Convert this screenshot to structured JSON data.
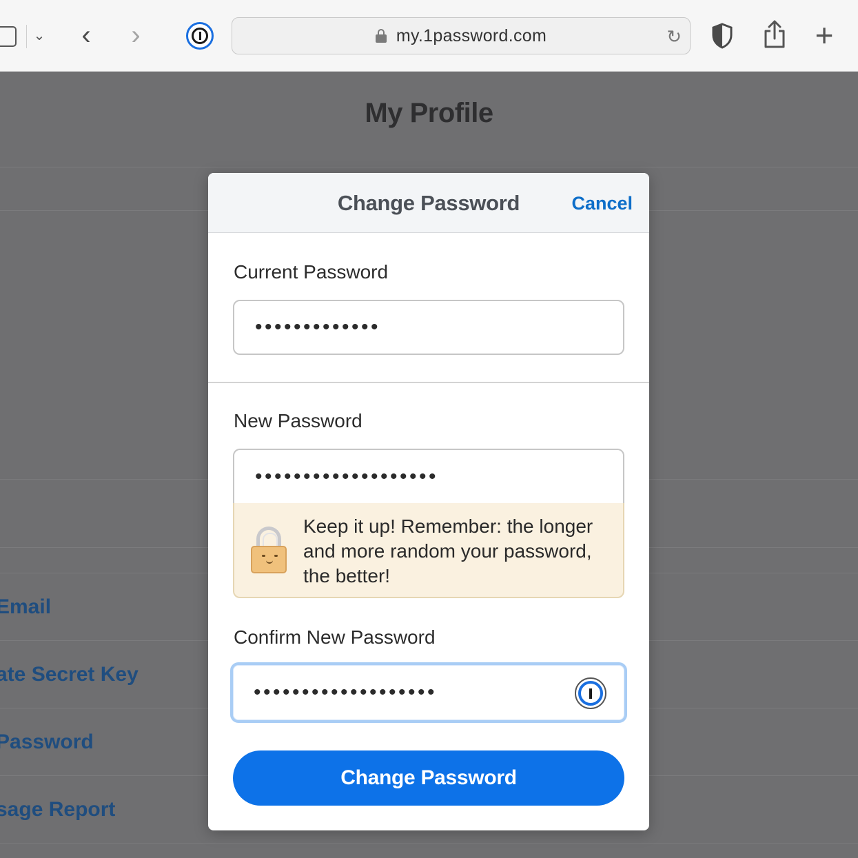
{
  "browser": {
    "url": "my.1password.com"
  },
  "page": {
    "title": "My Profile",
    "links": [
      "Email",
      "ate Secret Key",
      "Password",
      "sage Report"
    ]
  },
  "modal": {
    "title": "Change Password",
    "cancel_label": "Cancel",
    "current_password": {
      "label": "Current Password",
      "value": "•••••••••••••"
    },
    "new_password": {
      "label": "New Password",
      "value": "•••••••••••••••••••",
      "strength_message": "Keep it up! Remember: the longer and more random your password, the better!"
    },
    "confirm_password": {
      "label": "Confirm New Password",
      "value": "•••••••••••••••••••"
    },
    "submit_label": "Change Password"
  },
  "colors": {
    "accent": "#0d72e8",
    "link": "#0d6ec9",
    "strength_bg": "#faf1e0"
  }
}
